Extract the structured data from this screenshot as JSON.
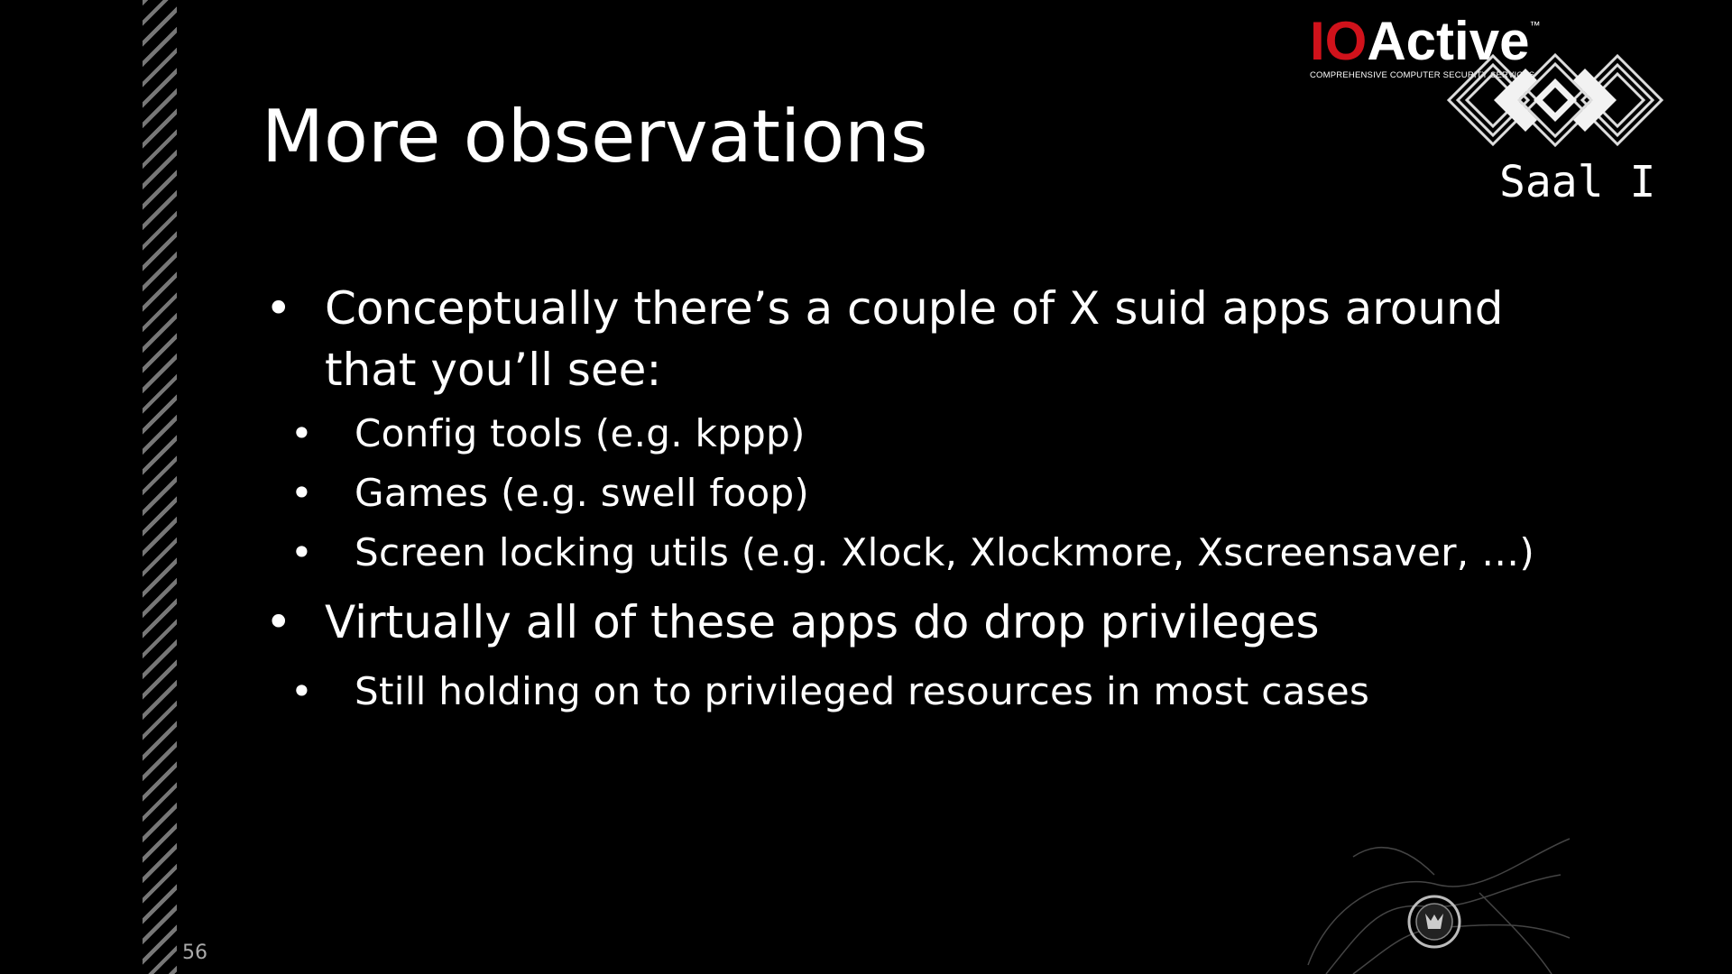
{
  "slide": {
    "title": "More observations",
    "page_number": "56",
    "bullets": [
      {
        "text": "Conceptually there’s a couple of X suid apps around",
        "continuation": "that you’ll see:"
      },
      {
        "sub": [
          "Config tools (e.g. kppp)",
          "Games (e.g. swell foop)",
          "Screen locking utils (e.g. Xlock, Xlockmore, Xscreensaver, …)"
        ]
      },
      {
        "text": "Virtually all of these apps do drop privileges"
      },
      {
        "sub": [
          "Still holding on to privileged resources in most cases"
        ]
      }
    ]
  },
  "branding": {
    "ioactive": {
      "io": "IO",
      "active": "Active",
      "tm": "™",
      "tagline": "COMPREHENSIVE COMPUTER SECURITY SERVICES"
    },
    "room": "Saal I",
    "icons": [
      "ioactive-logo",
      "ccc-logo",
      "smoke-emblem-icon"
    ]
  },
  "colors": {
    "background": "#000000",
    "text": "#ffffff",
    "accent": "#d0121b",
    "stripes": "#777777"
  }
}
